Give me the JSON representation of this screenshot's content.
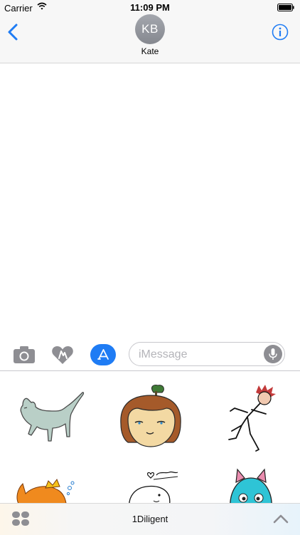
{
  "status_bar": {
    "carrier": "Carrier",
    "time": "11:09 PM"
  },
  "nav": {
    "avatar_initials": "KB",
    "contact_name": "Kate"
  },
  "input": {
    "placeholder": "iMessage"
  },
  "stickers": [
    {
      "name": "grey-cat-sticker"
    },
    {
      "name": "girl-face-sticker"
    },
    {
      "name": "stick-figure-sticker"
    },
    {
      "name": "goldfish-sticker"
    },
    {
      "name": "white-creature-sticker"
    },
    {
      "name": "blue-monster-sticker"
    }
  ],
  "app_bar": {
    "app_name": "1Diligent"
  },
  "colors": {
    "accent": "#1f7cf4",
    "avatar": "#8e9198",
    "nav_background": "#f7f7f7"
  }
}
